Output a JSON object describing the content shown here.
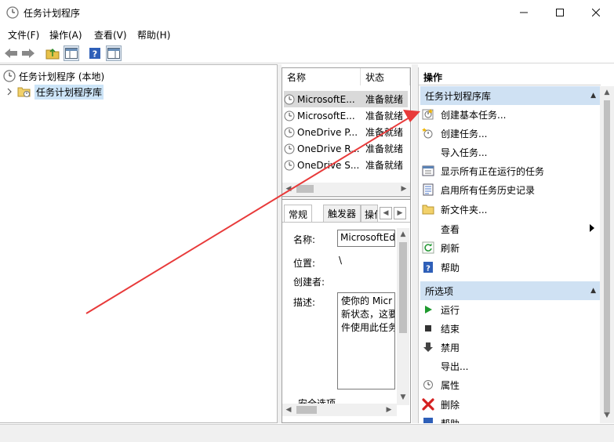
{
  "window": {
    "title": "任务计划程序"
  },
  "menu": {
    "file": "文件(F)",
    "action": "操作(A)",
    "view": "查看(V)",
    "help": "帮助(H)"
  },
  "tree": {
    "root": "任务计划程序 (本地)",
    "library": "任务计划程序库"
  },
  "task_list": {
    "col_name": "名称",
    "col_status": "状态",
    "rows": [
      {
        "name": "MicrosoftE...",
        "status": "准备就绪"
      },
      {
        "name": "MicrosoftE...",
        "status": "准备就绪"
      },
      {
        "name": "OneDrive P...",
        "status": "准备就绪"
      },
      {
        "name": "OneDrive R...",
        "status": "准备就绪"
      },
      {
        "name": "OneDrive S...",
        "status": "准备就绪"
      }
    ]
  },
  "details": {
    "tab_general": "常规",
    "tab_triggers": "触发器",
    "tab_actions": "操作",
    "label_name": "名称:",
    "value_name": "MicrosoftEd",
    "label_location": "位置:",
    "value_location": "\\",
    "label_author": "创建者:",
    "label_description": "描述:",
    "value_description_1": "使你的 Micr",
    "value_description_2": "新状态，这要",
    "value_description_3": "件使用此任务",
    "security_options": "安全选项"
  },
  "actions": {
    "header": "操作",
    "section1": "任务计划程序库",
    "items1": [
      "创建基本任务...",
      "创建任务...",
      "导入任务...",
      "显示所有正在运行的任务",
      "启用所有任务历史记录",
      "新文件夹...",
      "查看",
      "刷新",
      "帮助"
    ],
    "section2": "所选项",
    "items2": [
      "运行",
      "结束",
      "禁用",
      "导出...",
      "属性",
      "删除",
      "帮助"
    ]
  },
  "colors": {
    "accent_header": "#cfe1f3",
    "annotation_arrow": "#e83a3a"
  }
}
